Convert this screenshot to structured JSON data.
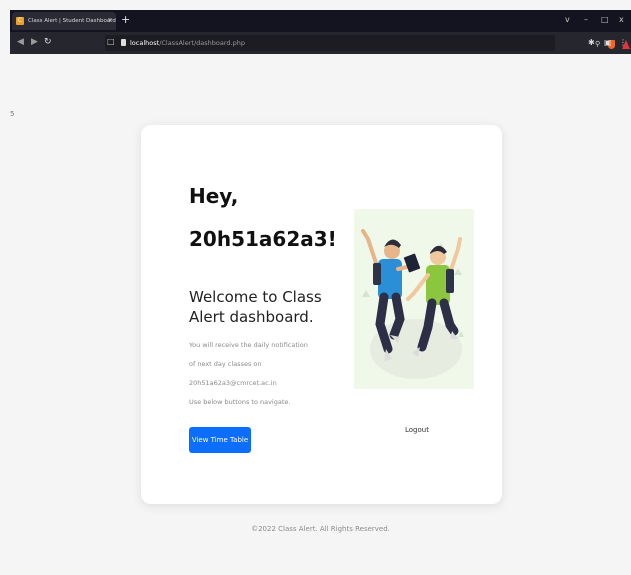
{
  "browser": {
    "tab_title": "Class Alert | Student Dashboard",
    "tab_close": "x",
    "new_tab": "+",
    "url_host": "localhost",
    "url_path": "/ClassAlert/dashboard.php",
    "window_controls": [
      "v",
      "–",
      "□",
      "x"
    ],
    "nav_icons": [
      "back-icon",
      "forward-icon",
      "reload-icon"
    ]
  },
  "page": {
    "greeting": "Hey,",
    "username": "20h51a62a3!",
    "welcome": "Welcome to Class Alert dashboard.",
    "info_lines": [
      "You will receive the daily notification",
      "of next day classes on",
      "20h51a62a3@cmrcet.ac.in",
      "Use below buttons to navigate."
    ],
    "view_timetable_label": "View Time Table",
    "logout_label": "Logout",
    "footer": "©2022 Class Alert. All Rights Reserved.",
    "stray_mark": "5"
  },
  "colors": {
    "primary_button": "#0d6efd",
    "shirt_blue": "#2a8fd6",
    "shirt_green": "#8cc63f",
    "pants": "#2c2f45"
  }
}
